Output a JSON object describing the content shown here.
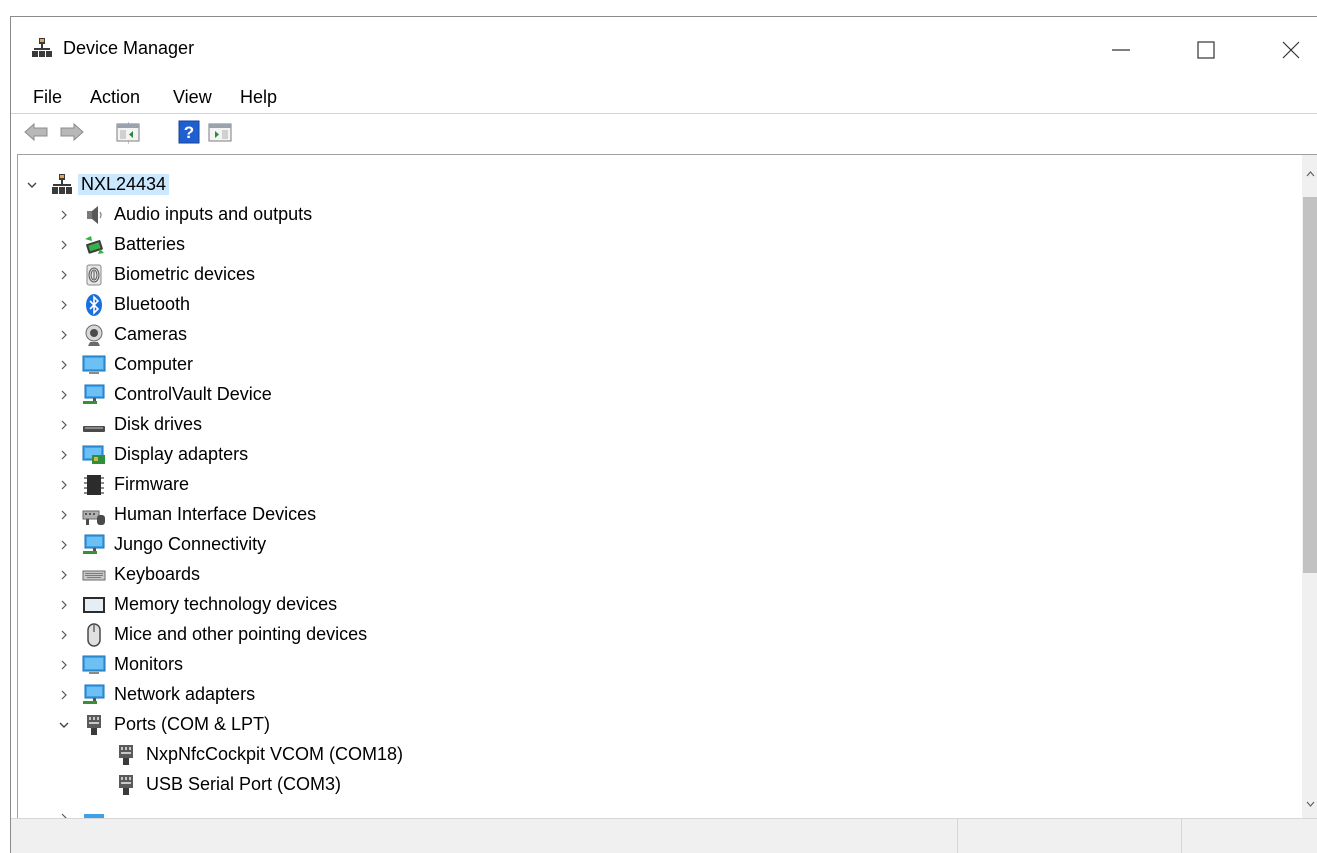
{
  "window": {
    "title": "Device Manager"
  },
  "menu": [
    "File",
    "Action",
    "View",
    "Help"
  ],
  "toolbar": {
    "buttons": [
      "back-icon",
      "forward-icon",
      "show-hide-console-tree-icon",
      "help-icon",
      "show-action-pane-icon"
    ]
  },
  "tree": {
    "root": {
      "label": "NXL24434",
      "expanded": true
    },
    "categories": [
      {
        "label": "Audio inputs and outputs",
        "icon": "speaker-icon"
      },
      {
        "label": "Batteries",
        "icon": "battery-icon"
      },
      {
        "label": "Biometric devices",
        "icon": "fingerprint-icon"
      },
      {
        "label": "Bluetooth",
        "icon": "bluetooth-icon"
      },
      {
        "label": "Cameras",
        "icon": "camera-icon"
      },
      {
        "label": "Computer",
        "icon": "computer-icon"
      },
      {
        "label": "ControlVault Device",
        "icon": "network-computer-icon"
      },
      {
        "label": "Disk drives",
        "icon": "disk-drive-icon"
      },
      {
        "label": "Display adapters",
        "icon": "display-adapter-icon"
      },
      {
        "label": "Firmware",
        "icon": "firmware-icon"
      },
      {
        "label": "Human Interface Devices",
        "icon": "hid-icon"
      },
      {
        "label": "Jungo Connectivity",
        "icon": "network-computer-icon"
      },
      {
        "label": "Keyboards",
        "icon": "keyboard-icon"
      },
      {
        "label": "Memory technology devices",
        "icon": "memory-icon"
      },
      {
        "label": "Mice and other pointing devices",
        "icon": "mouse-icon"
      },
      {
        "label": "Monitors",
        "icon": "monitor-icon"
      },
      {
        "label": "Network adapters",
        "icon": "network-computer-icon"
      },
      {
        "label": "Ports (COM & LPT)",
        "icon": "port-icon",
        "expanded": true,
        "children": [
          {
            "label": "NxpNfcCockpit VCOM (COM18)",
            "icon": "port-icon"
          },
          {
            "label": "USB Serial Port (COM3)",
            "icon": "port-icon"
          }
        ]
      }
    ]
  },
  "colors": {
    "selection": "#cce8ff",
    "accent": "#0a64d4"
  }
}
